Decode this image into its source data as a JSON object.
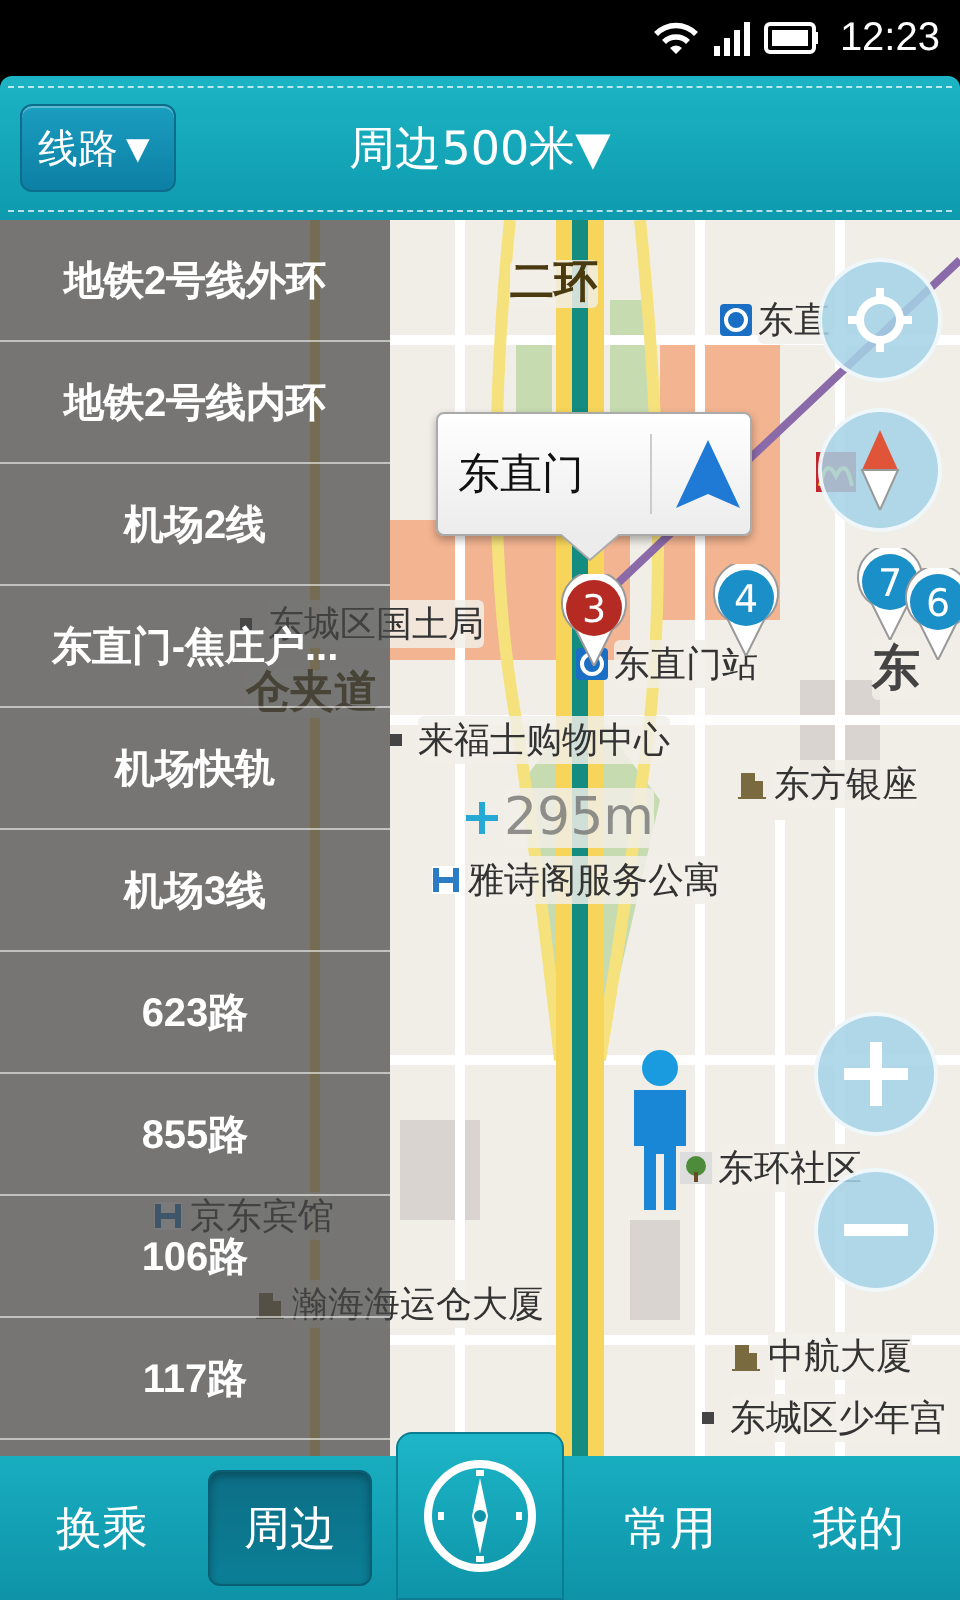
{
  "status_bar": {
    "time": "12:23"
  },
  "header": {
    "route_button": "线路▼",
    "title": "周边500米▼"
  },
  "route_list": [
    {
      "label": "地铁2号线外环"
    },
    {
      "label": "地铁2号线内环"
    },
    {
      "label": "机场2线"
    },
    {
      "label": "东直门-焦庄户..."
    },
    {
      "label": "机场快轨"
    },
    {
      "label": "机场3线"
    },
    {
      "label": "623路"
    },
    {
      "label": "855路"
    },
    {
      "label": "106路"
    },
    {
      "label": "117路"
    }
  ],
  "map": {
    "labels": [
      {
        "text": "二环",
        "kind": "road"
      },
      {
        "text": "东直",
        "kind": "subway"
      },
      {
        "text": "东城区国土局",
        "kind": "place"
      },
      {
        "text": "东直门站",
        "kind": "subway"
      },
      {
        "text": "东",
        "kind": "district"
      },
      {
        "text": "仓夹道",
        "kind": "road"
      },
      {
        "text": "来福士购物中心",
        "kind": "place"
      },
      {
        "text": "东方银座",
        "kind": "building"
      },
      {
        "text": "雅诗阁服务公寓",
        "kind": "hotel"
      },
      {
        "text": "东环社区",
        "kind": "park"
      },
      {
        "text": "京东宾馆",
        "kind": "hotel"
      },
      {
        "text": "瀚海海运仓大厦",
        "kind": "building"
      },
      {
        "text": "中航大厦",
        "kind": "building"
      },
      {
        "text": "东城区少年宫",
        "kind": "place"
      }
    ],
    "distance": "295m",
    "markers": [
      {
        "label": "3",
        "color": "#b52a22"
      },
      {
        "label": "4",
        "color": "#1a8fc8"
      },
      {
        "label": "7",
        "color": "#1a8fc8"
      },
      {
        "label": "6",
        "color": "#1a8fc8"
      }
    ],
    "popup": {
      "title": "东直门"
    }
  },
  "bottom_nav": [
    {
      "label": "换乘",
      "kind": "tab",
      "selected": false
    },
    {
      "label": "周边",
      "kind": "tab",
      "selected": true
    },
    {
      "kind": "compass"
    },
    {
      "label": "常用",
      "kind": "tab",
      "selected": false
    },
    {
      "label": "我的",
      "kind": "tab",
      "selected": false
    }
  ]
}
